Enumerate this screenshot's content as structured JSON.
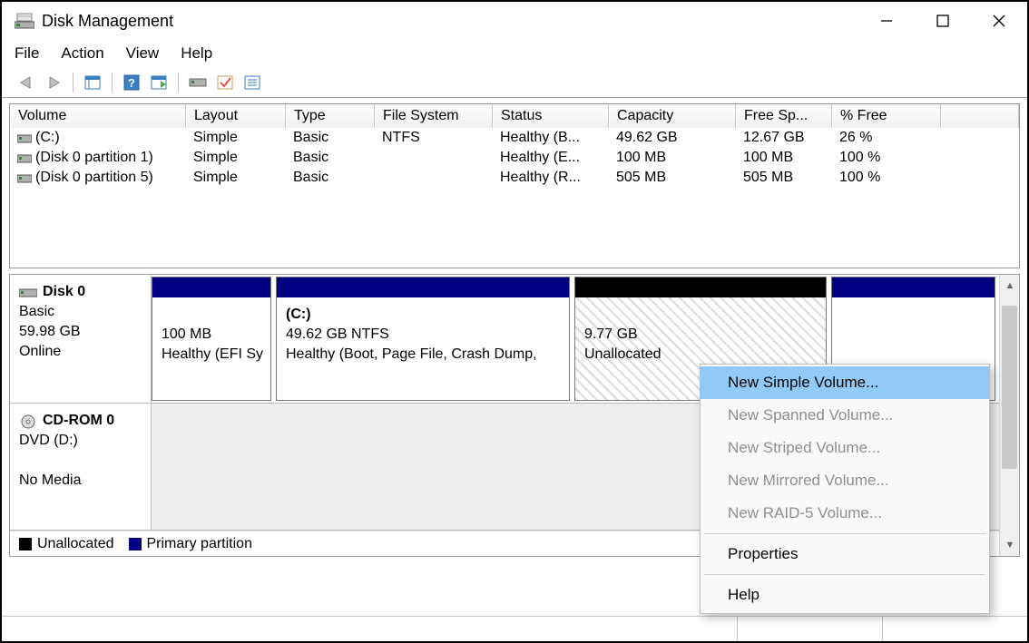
{
  "window": {
    "title": "Disk Management"
  },
  "menu": [
    "File",
    "Action",
    "View",
    "Help"
  ],
  "volumes": {
    "headers": [
      "Volume",
      "Layout",
      "Type",
      "File System",
      "Status",
      "Capacity",
      "Free Sp...",
      "% Free"
    ],
    "rows": [
      {
        "volume": "(C:)",
        "layout": "Simple",
        "type": "Basic",
        "fs": "NTFS",
        "status": "Healthy (B...",
        "capacity": "49.62 GB",
        "free": "12.67 GB",
        "pct": "26 %"
      },
      {
        "volume": "(Disk 0 partition 1)",
        "layout": "Simple",
        "type": "Basic",
        "fs": "",
        "status": "Healthy (E...",
        "capacity": "100 MB",
        "free": "100 MB",
        "pct": "100 %"
      },
      {
        "volume": "(Disk 0 partition 5)",
        "layout": "Simple",
        "type": "Basic",
        "fs": "",
        "status": "Healthy (R...",
        "capacity": "505 MB",
        "free": "505 MB",
        "pct": "100 %"
      }
    ]
  },
  "disk0": {
    "name": "Disk 0",
    "type": "Basic",
    "size": "59.98 GB",
    "state": "Online",
    "partitions": {
      "efi": {
        "size": "100 MB",
        "status": "Healthy (EFI Sy"
      },
      "c": {
        "label": "(C:)",
        "size_fs": "49.62 GB NTFS",
        "status": "Healthy (Boot, Page File, Crash Dump,"
      },
      "unalloc": {
        "size": "9.77 GB",
        "label": "Unallocated"
      }
    }
  },
  "cdrom": {
    "name": "CD-ROM 0",
    "label": "DVD (D:)",
    "state": "No Media"
  },
  "legend": {
    "unallocated": "Unallocated",
    "primary": "Primary partition"
  },
  "context_menu": {
    "new_simple": "New Simple Volume...",
    "new_spanned": "New Spanned Volume...",
    "new_striped": "New Striped Volume...",
    "new_mirrored": "New Mirrored Volume...",
    "new_raid5": "New RAID-5 Volume...",
    "properties": "Properties",
    "help": "Help"
  }
}
